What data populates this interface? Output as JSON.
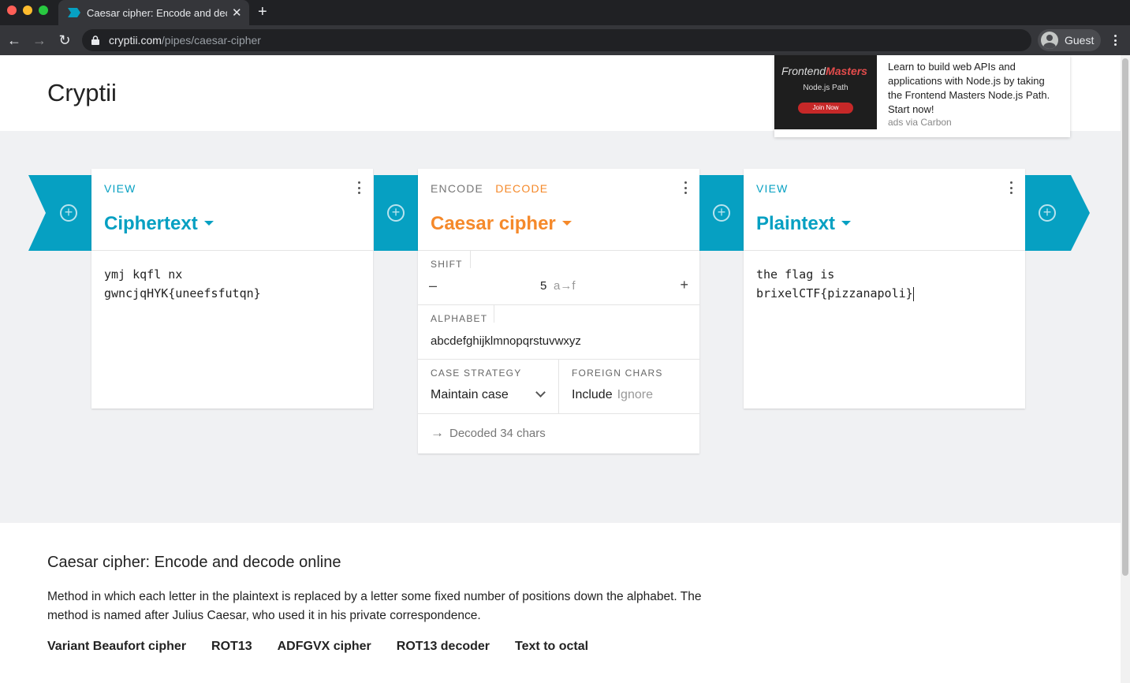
{
  "browser": {
    "tab_title": "Caesar cipher: Encode and decode online",
    "url_host": "cryptii.com",
    "url_path": "/pipes/caesar-cipher",
    "profile_label": "Guest",
    "accent": "#06a0c2"
  },
  "site": {
    "title": "Cryptii"
  },
  "ad": {
    "brand_light": "Frontend",
    "brand_bold": "Masters",
    "path_label": "Node.js Path",
    "button_label": "Join Now",
    "text": "Learn to build web APIs and applications with Node.js by taking the Frontend Masters Node.js Path. Start now!",
    "via": "ads via Carbon"
  },
  "pipeline": {
    "left_card": {
      "mode": "VIEW",
      "title": "Ciphertext",
      "content": "ymj kqfl nx\ngwncjqHYK{uneefsfutqn}"
    },
    "encoder": {
      "mode_encode": "ENCODE",
      "mode_decode": "DECODE",
      "title": "Caesar cipher",
      "shift_label": "SHIFT",
      "shift_minus": "–",
      "shift_value": "5",
      "shift_mapping": "a→f",
      "shift_plus": "+",
      "alphabet_label": "ALPHABET",
      "alphabet_value": "abcdefghijklmnopqrstuvwxyz",
      "case_label": "CASE STRATEGY",
      "case_value": "Maintain case",
      "foreign_label": "FOREIGN CHARS",
      "foreign_include": "Include",
      "foreign_ignore": "Ignore",
      "status": "Decoded 34 chars"
    },
    "right_card": {
      "mode": "VIEW",
      "title": "Plaintext",
      "content": "the flag is\nbrixelCTF{pizzanapoli}"
    }
  },
  "info": {
    "title": "Caesar cipher: Encode and decode online",
    "description": "Method in which each letter in the plaintext is replaced by a letter some fixed number of positions down the alphabet. The method is named after Julius Caesar, who used it in his private correspondence.",
    "related": [
      "Variant Beaufort cipher",
      "ROT13",
      "ADFGVX cipher",
      "ROT13 decoder",
      "Text to octal"
    ]
  }
}
